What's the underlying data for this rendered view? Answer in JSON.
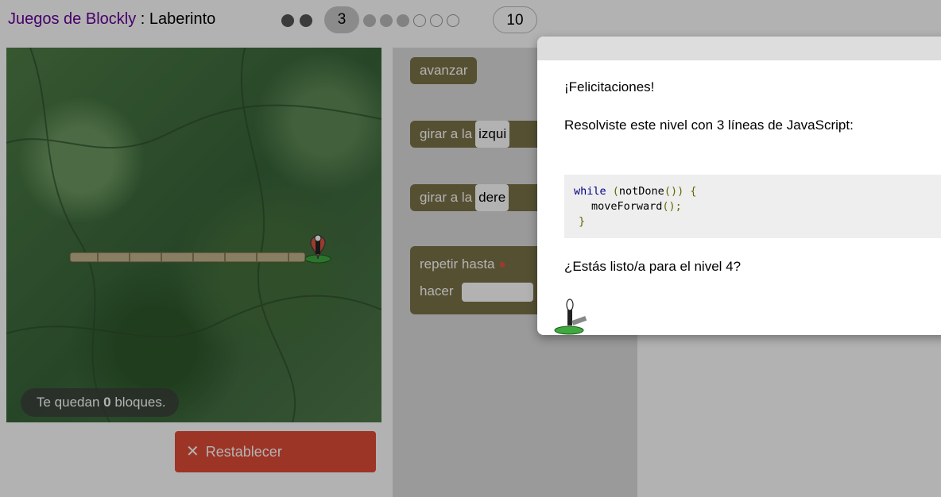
{
  "header": {
    "title_link": "Juegos de Blockly",
    "title_separator": " : ",
    "title_game": "Laberinto",
    "current_level": "3",
    "last_level": "10"
  },
  "maze": {
    "capacity_prefix": "Te quedan ",
    "capacity_count": "0",
    "capacity_suffix": " bloques.",
    "reset_label": "Restablecer",
    "reset_icon": "close-icon"
  },
  "toolbox": {
    "move_forward": "avanzar",
    "turn_label": "girar a la",
    "turn_left_value": "izqui",
    "turn_right_value": "dere",
    "repeat_until": "repetir hasta",
    "do_label": "hacer"
  },
  "dialog": {
    "congrats": "¡Felicitaciones!",
    "solved_text": "Resolviste este nivel con 3 líneas de JavaScript:",
    "code": {
      "line1_kw": "while",
      "line1_open": " (",
      "line1_fn": "notDone",
      "line1_parens": "())",
      "line1_brace": " {",
      "line2_fn": "moveForward",
      "line2_parens": "();",
      "line3_brace": "}"
    },
    "next_question": "¿Estás listo/a para el nivel 4?"
  },
  "colors": {
    "title_link": "#660099",
    "reset_button": "#e14c38",
    "block": "#7c7348",
    "code_keyword": "#000088",
    "code_punct": "#666600"
  }
}
